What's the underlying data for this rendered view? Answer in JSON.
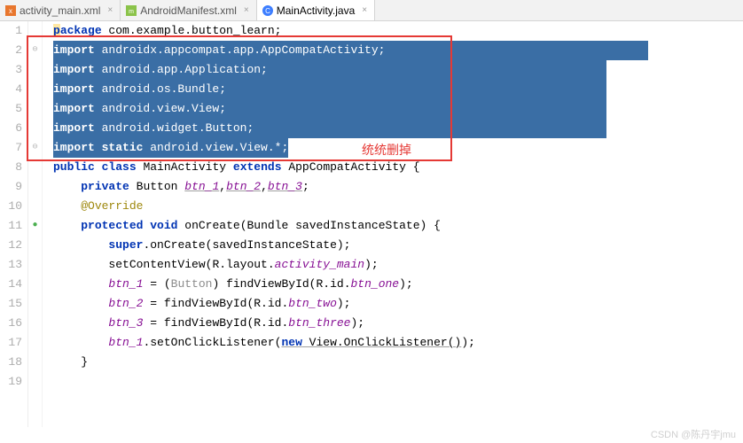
{
  "tabs": [
    {
      "icon": "xml",
      "label": "activity_main.xml",
      "active": false
    },
    {
      "icon": "xml",
      "label": "AndroidManifest.xml",
      "active": false
    },
    {
      "icon": "java",
      "label": "MainActivity.java",
      "active": true
    }
  ],
  "gutter": [
    "1",
    "2",
    "3",
    "4",
    "5",
    "6",
    "7",
    "8",
    "9",
    "10",
    "11",
    "12",
    "13",
    "14",
    "15",
    "16",
    "17",
    "18",
    "19"
  ],
  "code": {
    "l1_kw": "package",
    "l1_rest": " com.example.button_learn;",
    "l2_kw": "import",
    "l2_rest": " androidx.appcompat.app.AppCompatActivity;",
    "l3_kw": "import",
    "l3_rest": " android.app.Application;",
    "l4_kw": "import",
    "l4_rest": " android.os.Bundle;",
    "l5_kw": "import",
    "l5_rest": " android.view.View;",
    "l6_kw": "import",
    "l6_rest": " android.widget.Button;",
    "l7_kw": "import",
    "l7_kw2": "static",
    "l7_rest": " android.view.View.*;",
    "l8_kw1": "public",
    "l8_kw2": "class",
    "l8_name": "MainActivity",
    "l8_kw3": "extends",
    "l8_sup": "AppCompatActivity",
    "l8_brace": " {",
    "l9_kw": "private",
    "l9_type": "Button",
    "l9_f1": "btn_1",
    "l9_f2": "btn_2",
    "l9_f3": "btn_3",
    "l10_ann": "@Override",
    "l11_kw1": "protected",
    "l11_kw2": "void",
    "l11_name": "onCreate",
    "l11_params": "(Bundle savedInstanceState) {",
    "l12_kw": "super",
    "l12_rest": ".onCreate(savedInstanceState);",
    "l13_a": "setContentView(R.layout.",
    "l13_b": "activity_main",
    "l13_c": ");",
    "l14_a": "btn_1",
    "l14_b": " = (",
    "l14_c": "Button",
    "l14_d": ") findViewById(R.id.",
    "l14_e": "btn_one",
    "l14_f": ");",
    "l15_a": "btn_2",
    "l15_b": " = findViewById(R.id.",
    "l15_c": "btn_two",
    "l15_d": ");",
    "l16_a": "btn_3",
    "l16_b": " = findViewById(R.id.",
    "l16_c": "btn_three",
    "l16_d": ");",
    "l17_a": "btn_1",
    "l17_b": ".setOnClickListener(",
    "l17_kw": "new",
    "l17_c": " View.OnClickListener()",
    "l17_d": ");",
    "l18": "}",
    "l19": ""
  },
  "annotation": "统统删掉",
  "watermark": "CSDN @陈丹宇jmu"
}
